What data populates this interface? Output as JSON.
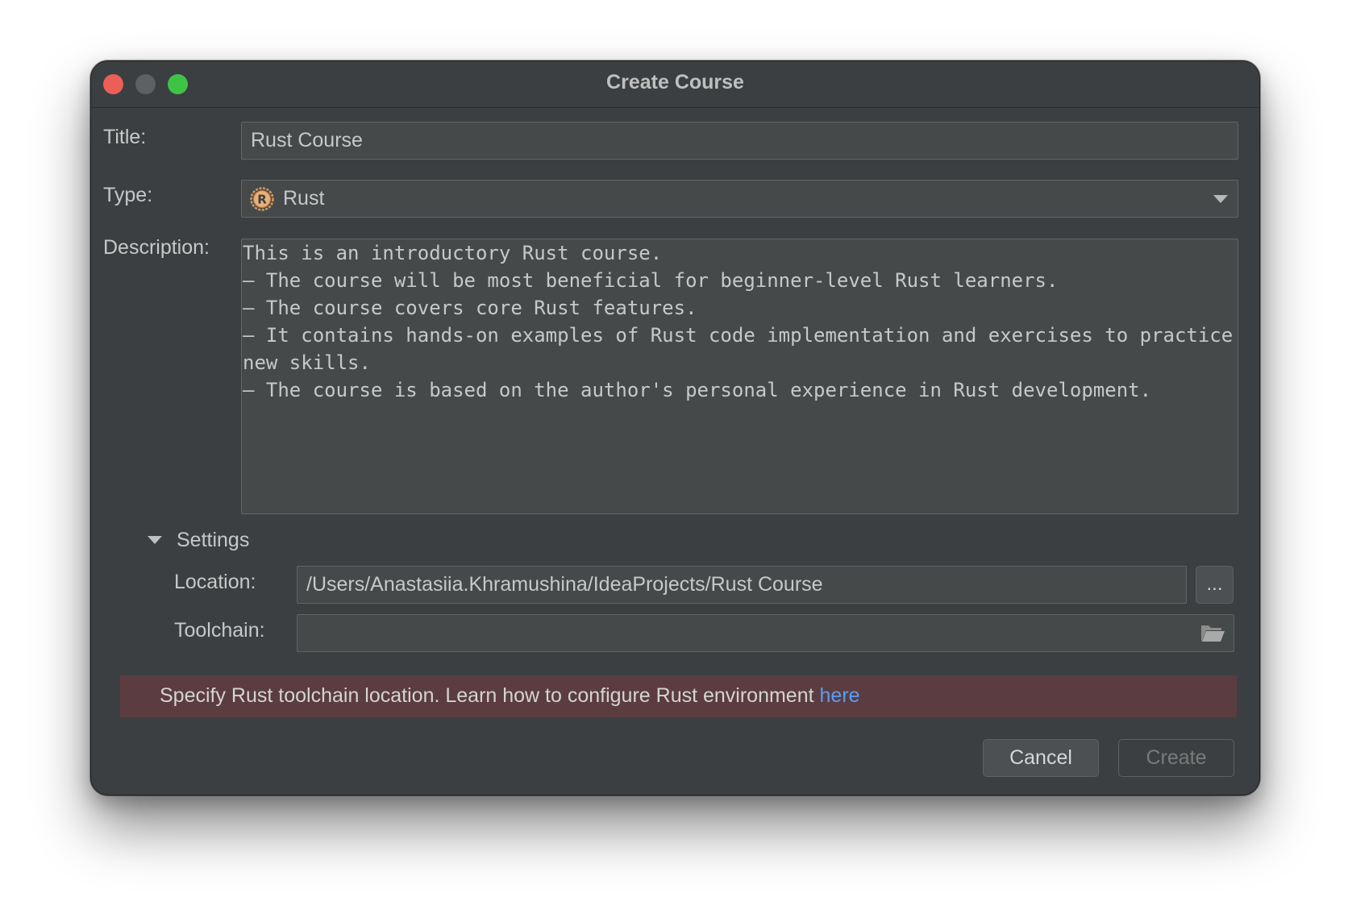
{
  "window": {
    "title": "Create Course"
  },
  "form": {
    "title_label": "Title:",
    "title_value": "Rust Course",
    "type_label": "Type:",
    "type_value": "Rust",
    "type_icon": "rust-logo-icon",
    "description_label": "Description:",
    "description_value": "This is an introductory Rust course.\n– The course will be most beneficial for beginner-level Rust learners.\n– The course covers core Rust features.\n– It contains hands-on examples of Rust code implementation and exercises to practice new skills.\n– The course is based on the author's personal experience in Rust development."
  },
  "settings": {
    "section_label": "Settings",
    "expanded": true,
    "location_label": "Location:",
    "location_value": "/Users/Anastasiia.Khramushina/IdeaProjects/Rust Course",
    "browse_label": "...",
    "toolchain_label": "Toolchain:",
    "toolchain_value": "",
    "toolchain_icon": "folder-icon"
  },
  "error": {
    "message": "Specify Rust toolchain location. Learn how to configure Rust environment ",
    "link_text": "here"
  },
  "buttons": {
    "cancel": "Cancel",
    "create": "Create"
  },
  "colors": {
    "window_bg": "#3c3f41",
    "field_bg": "#45494a",
    "error_bg": "#5b3c40",
    "link": "#589df6",
    "close": "#ec5f57",
    "maximize": "#3fc347"
  }
}
